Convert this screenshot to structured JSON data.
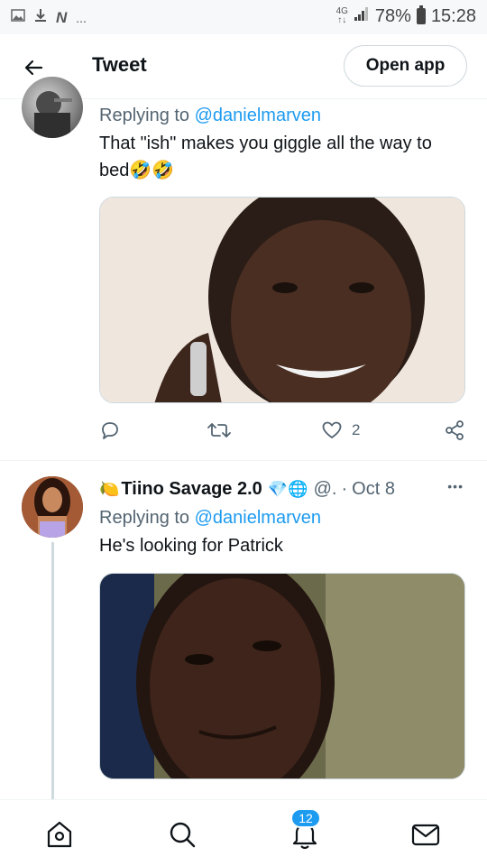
{
  "status_bar": {
    "network_type": "4G",
    "battery_percent": "78%",
    "time": "15:28",
    "overflow": "..."
  },
  "header": {
    "title": "Tweet",
    "open_app_label": "Open app"
  },
  "tweets": [
    {
      "reply_prefix": "Replying to ",
      "reply_mention": "@danielmarven",
      "text": "That \"ish\" makes you giggle all the way to bed🤣🤣",
      "like_count": "2",
      "icons": [
        "reply-icon",
        "retweet-icon",
        "like-icon",
        "share-icon"
      ]
    },
    {
      "author_emoji": "🍋",
      "author_name": "Tiino Savage 2.0",
      "author_badges": "💎🌐",
      "handle": "@.",
      "separator": "·",
      "date": "Oct 8",
      "more": "•••",
      "reply_prefix": "Replying to ",
      "reply_mention": "@danielmarven",
      "text": "He's looking for Patrick"
    }
  ],
  "bottom_nav": {
    "notifications_badge": "12",
    "items": [
      "home-icon",
      "search-icon",
      "notifications-icon",
      "messages-icon"
    ]
  },
  "colors": {
    "accent": "#1d9bf0",
    "text_primary": "#0f1419",
    "text_secondary": "#536471",
    "border": "#cfd9de"
  }
}
